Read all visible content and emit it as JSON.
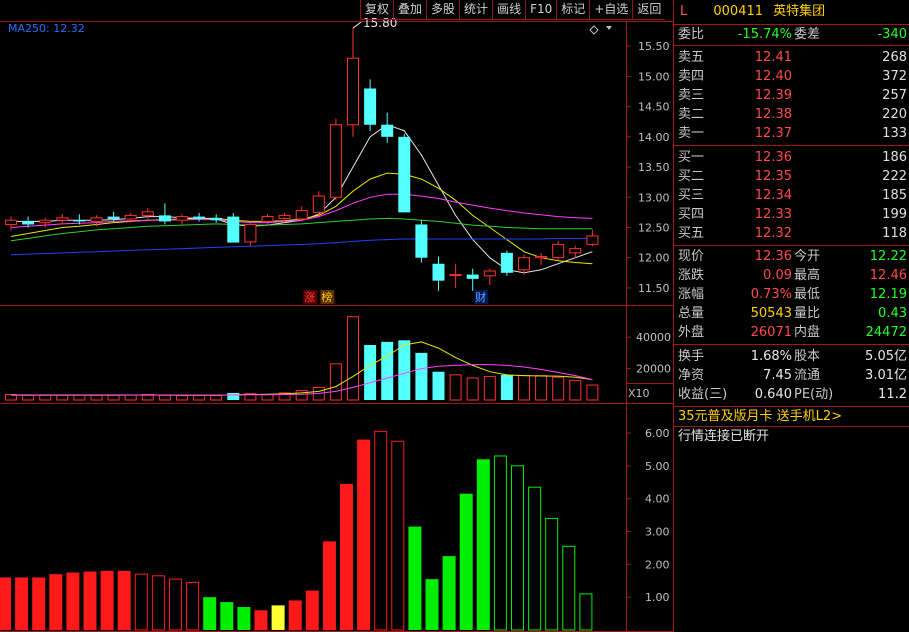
{
  "toolbar": {
    "buttons": [
      "复权",
      "叠加",
      "多股",
      "统计",
      "画线",
      "F10",
      "标记",
      "+自选",
      "返回"
    ]
  },
  "legend": {
    "ma_label": "MA250: 12.32"
  },
  "stock": {
    "l_marker": "L",
    "code": "000411",
    "name": "英特集团"
  },
  "weibi": {
    "label": "委比",
    "value": "-15.74%",
    "label2": "委差",
    "value2": "-340"
  },
  "sells": [
    {
      "label": "卖五",
      "price": "12.41",
      "vol": "268"
    },
    {
      "label": "卖四",
      "price": "12.40",
      "vol": "372"
    },
    {
      "label": "卖三",
      "price": "12.39",
      "vol": "257"
    },
    {
      "label": "卖二",
      "price": "12.38",
      "vol": "220"
    },
    {
      "label": "卖一",
      "price": "12.37",
      "vol": "133"
    }
  ],
  "buys": [
    {
      "label": "买一",
      "price": "12.36",
      "vol": "186"
    },
    {
      "label": "买二",
      "price": "12.35",
      "vol": "222"
    },
    {
      "label": "买三",
      "price": "12.34",
      "vol": "185"
    },
    {
      "label": "买四",
      "price": "12.33",
      "vol": "199"
    },
    {
      "label": "买五",
      "price": "12.32",
      "vol": "118"
    }
  ],
  "quote": [
    {
      "l1": "现价",
      "v1": "12.36",
      "c1": "red",
      "l2": "今开",
      "v2": "12.22",
      "c2": "green"
    },
    {
      "l1": "涨跌",
      "v1": "0.09",
      "c1": "red",
      "l2": "最高",
      "v2": "12.46",
      "c2": "red"
    },
    {
      "l1": "涨幅",
      "v1": "0.73%",
      "c1": "red",
      "l2": "最低",
      "v2": "12.19",
      "c2": "green"
    },
    {
      "l1": "总量",
      "v1": "50543",
      "c1": "yellow",
      "l2": "量比",
      "v2": "0.43",
      "c2": "green"
    },
    {
      "l1": "外盘",
      "v1": "26071",
      "c1": "red",
      "l2": "内盘",
      "v2": "24472",
      "c2": "green"
    }
  ],
  "fundamentals": [
    {
      "l1": "换手",
      "v1": "1.68%",
      "l2": "股本",
      "v2": "5.05亿"
    },
    {
      "l1": "净资",
      "v1": "7.45",
      "l2": "流通",
      "v2": "3.01亿"
    },
    {
      "l1": "收益(三)",
      "v1": "0.640",
      "l2": "PE(动)",
      "v2": "11.2"
    }
  ],
  "promo": "35元普及版月卡 送手机L2>",
  "status": "行情连接已断开",
  "colors": {
    "up": "#ff3030",
    "down": "#54ffff",
    "vol_bar_green": "#00ee00",
    "border": "#a01818"
  },
  "chart_data": [
    {
      "type": "candlestick",
      "price_axis": [
        "15.50",
        "15.00",
        "14.50",
        "14.00",
        "13.50",
        "13.00",
        "12.50",
        "12.00",
        "11.50"
      ],
      "ylim": [
        11.3,
        15.9
      ],
      "high_annotation": "15.80",
      "markers": [
        "涨",
        "榜",
        "财"
      ],
      "candles": [
        {
          "o": 12.55,
          "h": 12.68,
          "l": 12.45,
          "c": 12.62
        },
        {
          "o": 12.6,
          "h": 12.68,
          "l": 12.5,
          "c": 12.55
        },
        {
          "o": 12.58,
          "h": 12.66,
          "l": 12.5,
          "c": 12.62
        },
        {
          "o": 12.62,
          "h": 12.72,
          "l": 12.55,
          "c": 12.66
        },
        {
          "o": 12.62,
          "h": 12.72,
          "l": 12.55,
          "c": 12.6
        },
        {
          "o": 12.6,
          "h": 12.7,
          "l": 12.52,
          "c": 12.66
        },
        {
          "o": 12.68,
          "h": 12.76,
          "l": 12.6,
          "c": 12.64
        },
        {
          "o": 12.64,
          "h": 12.74,
          "l": 12.58,
          "c": 12.7
        },
        {
          "o": 12.7,
          "h": 12.82,
          "l": 12.62,
          "c": 12.76
        },
        {
          "o": 12.7,
          "h": 12.9,
          "l": 12.55,
          "c": 12.6
        },
        {
          "o": 12.62,
          "h": 12.72,
          "l": 12.54,
          "c": 12.68
        },
        {
          "o": 12.68,
          "h": 12.74,
          "l": 12.6,
          "c": 12.64
        },
        {
          "o": 12.66,
          "h": 12.72,
          "l": 12.58,
          "c": 12.62
        },
        {
          "o": 12.68,
          "h": 12.74,
          "l": 12.36,
          "c": 12.25
        },
        {
          "o": 12.26,
          "h": 12.6,
          "l": 12.2,
          "c": 12.55
        },
        {
          "o": 12.6,
          "h": 12.72,
          "l": 12.55,
          "c": 12.68
        },
        {
          "o": 12.65,
          "h": 12.74,
          "l": 12.58,
          "c": 12.7
        },
        {
          "o": 12.64,
          "h": 12.85,
          "l": 12.6,
          "c": 12.78
        },
        {
          "o": 12.75,
          "h": 13.1,
          "l": 12.7,
          "c": 13.02
        },
        {
          "o": 13.0,
          "h": 14.3,
          "l": 12.95,
          "c": 14.2
        },
        {
          "o": 14.2,
          "h": 15.8,
          "l": 14.0,
          "c": 15.3
        },
        {
          "o": 14.8,
          "h": 14.95,
          "l": 14.1,
          "c": 14.2
        },
        {
          "o": 14.2,
          "h": 14.4,
          "l": 13.9,
          "c": 14.0
        },
        {
          "o": 14.0,
          "h": 14.05,
          "l": 13.0,
          "c": 12.75
        },
        {
          "o": 12.55,
          "h": 12.62,
          "l": 11.92,
          "c": 12.0
        },
        {
          "o": 11.9,
          "h": 12.02,
          "l": 11.45,
          "c": 11.62
        },
        {
          "o": 11.72,
          "h": 11.9,
          "l": 11.5,
          "c": 11.72
        },
        {
          "o": 11.72,
          "h": 11.82,
          "l": 11.45,
          "c": 11.65
        },
        {
          "o": 11.7,
          "h": 11.82,
          "l": 11.55,
          "c": 11.78
        },
        {
          "o": 12.08,
          "h": 12.12,
          "l": 11.7,
          "c": 11.75
        },
        {
          "o": 11.8,
          "h": 12.05,
          "l": 11.72,
          "c": 12.0
        },
        {
          "o": 12.0,
          "h": 12.08,
          "l": 11.88,
          "c": 12.02
        },
        {
          "o": 12.0,
          "h": 12.28,
          "l": 11.95,
          "c": 12.22
        },
        {
          "o": 12.08,
          "h": 12.2,
          "l": 12.0,
          "c": 12.15
        },
        {
          "o": 12.22,
          "h": 12.46,
          "l": 12.19,
          "c": 12.36
        }
      ],
      "ma_lines": [
        {
          "color": "#e8e8e8",
          "values": [
            12.6,
            12.6,
            12.6,
            12.62,
            12.62,
            12.62,
            12.63,
            12.65,
            12.68,
            12.68,
            12.66,
            12.65,
            12.64,
            12.55,
            12.52,
            12.54,
            12.58,
            12.62,
            12.72,
            13.0,
            13.5,
            14.0,
            14.2,
            14.1,
            13.7,
            13.2,
            12.7,
            12.3,
            12.0,
            11.8,
            11.75,
            11.8,
            11.9,
            12.0,
            12.1
          ]
        },
        {
          "color": "#e8e800",
          "values": [
            12.35,
            12.4,
            12.45,
            12.5,
            12.52,
            12.55,
            12.58,
            12.6,
            12.62,
            12.63,
            12.64,
            12.65,
            12.65,
            12.62,
            12.6,
            12.6,
            12.61,
            12.64,
            12.7,
            12.85,
            13.1,
            13.3,
            13.4,
            13.38,
            13.3,
            13.15,
            12.95,
            12.7,
            12.5,
            12.3,
            12.1,
            12.0,
            11.95,
            11.92,
            11.9
          ]
        },
        {
          "color": "#ff40ff",
          "values": [
            12.5,
            12.52,
            12.54,
            12.56,
            12.57,
            12.58,
            12.6,
            12.61,
            12.62,
            12.62,
            12.63,
            12.63,
            12.63,
            12.6,
            12.58,
            12.58,
            12.6,
            12.62,
            12.68,
            12.78,
            12.9,
            13.0,
            13.05,
            13.05,
            13.02,
            12.98,
            12.92,
            12.87,
            12.82,
            12.78,
            12.74,
            12.71,
            12.68,
            12.66,
            12.65
          ]
        },
        {
          "color": "#30d030",
          "values": [
            12.28,
            12.32,
            12.36,
            12.4,
            12.43,
            12.46,
            12.48,
            12.5,
            12.52,
            12.53,
            12.54,
            12.55,
            12.56,
            12.55,
            12.54,
            12.54,
            12.55,
            12.56,
            12.58,
            12.6,
            12.62,
            12.64,
            12.65,
            12.64,
            12.62,
            12.6,
            12.57,
            12.54,
            12.52,
            12.5,
            12.49,
            12.48,
            12.48,
            12.48,
            12.48
          ]
        },
        {
          "color": "#2040ff",
          "values": [
            12.05,
            12.06,
            12.07,
            12.08,
            12.09,
            12.1,
            12.11,
            12.12,
            12.13,
            12.14,
            12.15,
            12.16,
            12.17,
            12.18,
            12.19,
            12.2,
            12.21,
            12.22,
            12.23,
            12.25,
            12.27,
            12.29,
            12.3,
            12.31,
            12.31,
            12.31,
            12.31,
            12.31,
            12.31,
            12.31,
            12.31,
            12.31,
            12.32,
            12.32,
            12.32
          ]
        }
      ]
    },
    {
      "type": "bar",
      "name": "volume",
      "axis": [
        "40000",
        "20000"
      ],
      "unit_label": "X10",
      "ylim": [
        0,
        56000
      ],
      "values": [
        3500,
        3000,
        3000,
        3000,
        3200,
        3000,
        3000,
        3200,
        3500,
        3000,
        2800,
        3000,
        2800,
        4500,
        4000,
        3500,
        4500,
        6000,
        8000,
        23000,
        53000,
        35000,
        37000,
        38000,
        30000,
        18000,
        16000,
        14000,
        15000,
        16000,
        15500,
        15500,
        14500,
        12500,
        9500
      ],
      "colors": [
        "up",
        "up",
        "up",
        "up",
        "up",
        "up",
        "up",
        "up",
        "up",
        "up",
        "up",
        "up",
        "up",
        "down",
        "up",
        "up",
        "up",
        "up",
        "up",
        "up",
        "up",
        "down",
        "down",
        "down",
        "down",
        "down",
        "up",
        "up",
        "up",
        "down",
        "up",
        "up",
        "up",
        "up",
        "up"
      ],
      "ma_lines": [
        {
          "color": "#e8e800",
          "values": [
            3200,
            3200,
            3200,
            3200,
            3200,
            3200,
            3200,
            3200,
            3200,
            3100,
            3000,
            3000,
            3000,
            3300,
            3500,
            3600,
            3900,
            4500,
            5500,
            8500,
            15000,
            22000,
            28000,
            35000,
            37000,
            33000,
            27000,
            22000,
            18000,
            16000,
            15500,
            15300,
            15200,
            14500,
            13000
          ]
        },
        {
          "color": "#ff40ff",
          "values": [
            3000,
            3000,
            3000,
            3000,
            3000,
            3000,
            3050,
            3100,
            3150,
            3200,
            3150,
            3100,
            3100,
            3200,
            3300,
            3400,
            3500,
            3700,
            4200,
            5500,
            8000,
            11000,
            14000,
            17000,
            20000,
            21500,
            22000,
            22500,
            22500,
            22000,
            21000,
            19500,
            17500,
            15500,
            13000
          ]
        }
      ]
    },
    {
      "type": "bar",
      "name": "indicator",
      "axis": [
        "6.00",
        "5.00",
        "4.00",
        "3.00",
        "2.00",
        "1.00"
      ],
      "ylim": [
        0,
        6.7
      ],
      "values": [
        1.6,
        1.6,
        1.6,
        1.7,
        1.75,
        1.78,
        1.8,
        1.8,
        1.7,
        1.65,
        1.55,
        1.45,
        1.0,
        0.85,
        0.7,
        0.6,
        0.75,
        0.9,
        1.2,
        2.7,
        4.45,
        5.8,
        6.05,
        5.75,
        3.15,
        1.55,
        2.25,
        4.15,
        5.2,
        5.3,
        5.0,
        4.35,
        3.4,
        2.55,
        1.1
      ],
      "styles": [
        "r",
        "r",
        "r",
        "r",
        "r",
        "r",
        "r",
        "r",
        "ro",
        "ro",
        "ro",
        "ro",
        "g",
        "g",
        "g",
        "r",
        "y",
        "r",
        "r",
        "r",
        "r",
        "r",
        "ro",
        "ro",
        "g",
        "g",
        "g",
        "g",
        "g",
        "go",
        "go",
        "go",
        "go",
        "go",
        "go"
      ]
    }
  ]
}
